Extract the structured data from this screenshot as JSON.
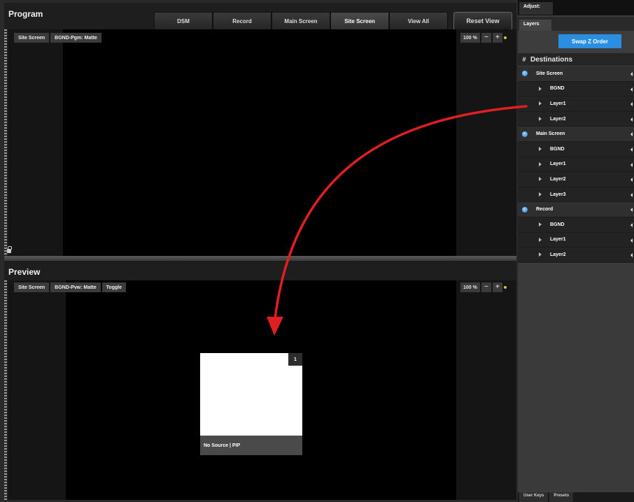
{
  "program": {
    "title": "Program",
    "tabs": [
      "DSM",
      "Record",
      "Main Screen",
      "Site Screen",
      "View All"
    ],
    "reset_label": "Reset View",
    "chips": [
      "Site Screen",
      "BGND-Pgm: Matte"
    ],
    "zoom": "100 %",
    "zoom_minus": "−",
    "zoom_plus": "+"
  },
  "preview": {
    "title": "Preview",
    "chips": [
      "Site Screen",
      "BGND-Pvw: Matte",
      "Toggle"
    ],
    "zoom": "100 %",
    "zoom_minus": "−",
    "zoom_plus": "+",
    "layer": {
      "number": "1",
      "caption": "No Source | PIP"
    }
  },
  "side": {
    "adjust_label": "Adjust:",
    "layers_tab": "Layers",
    "swap_label": "Swap Z Order",
    "dest_hash": "#",
    "dest_header": "Destinations",
    "rows": [
      {
        "label": "Site Screen",
        "type": "group"
      },
      {
        "label": "BGND",
        "type": "layer"
      },
      {
        "label": "Layer1",
        "type": "layer"
      },
      {
        "label": "Layer2",
        "type": "layer"
      },
      {
        "label": "Main Screen",
        "type": "group"
      },
      {
        "label": "BGND",
        "type": "layer"
      },
      {
        "label": "Layer1",
        "type": "layer"
      },
      {
        "label": "Layer2",
        "type": "layer"
      },
      {
        "label": "Layer3",
        "type": "layer"
      },
      {
        "label": "Record",
        "type": "group"
      },
      {
        "label": "BGND",
        "type": "layer"
      },
      {
        "label": "Layer1",
        "type": "layer"
      },
      {
        "label": "Layer2",
        "type": "layer"
      }
    ],
    "bottom_tabs": [
      "User Keys",
      "Presets"
    ]
  },
  "colors": {
    "accent_blue": "#2b8ee0",
    "annotation_arrow": "#e02020",
    "zoom_indicator": "#d6c43a"
  }
}
